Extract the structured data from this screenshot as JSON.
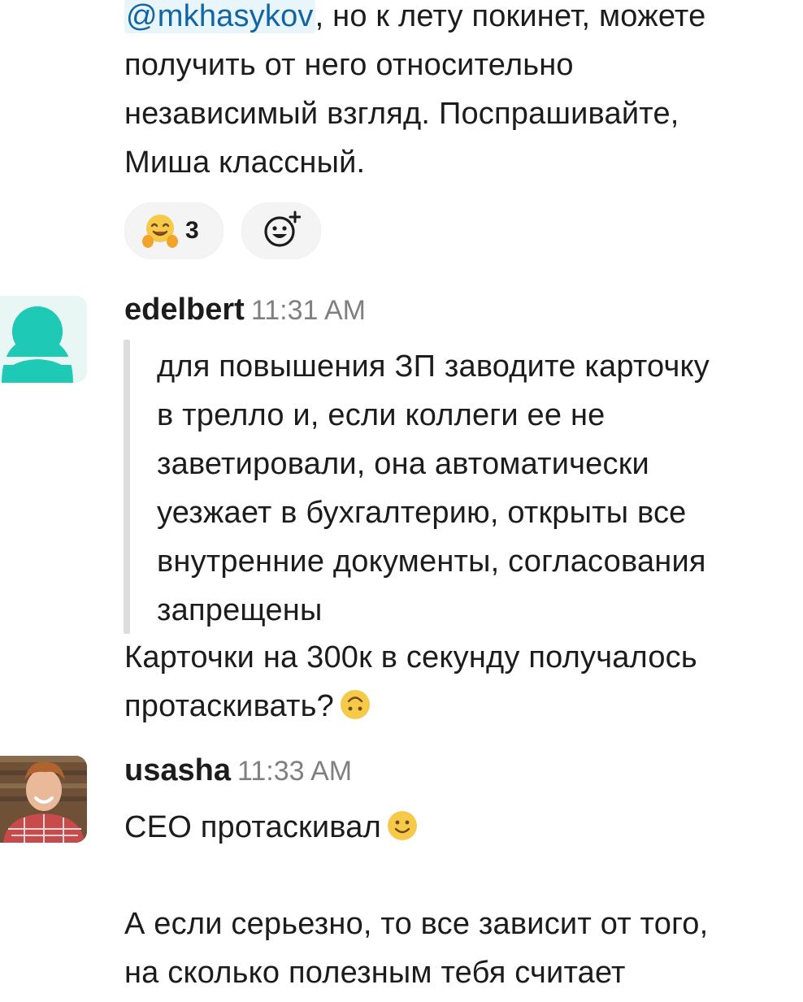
{
  "messages": {
    "first": {
      "mention": "@mkhasykov",
      "line1_rest": ", но к лету покинет, можете",
      "line2": "получить от него относительно",
      "line3": "независимый взгляд. Поспрашивайте,",
      "line4": "Миша классный.",
      "reactions": [
        {
          "icon": "hugging-face-icon",
          "count": "3"
        },
        {
          "icon": "add-reaction-icon"
        }
      ]
    },
    "edelbert": {
      "name": "edelbert",
      "time": "11:31 AM",
      "quote_lines": [
        "для повышения ЗП заводите карточку",
        "в трелло и, если коллеги ее не",
        "заветировали, она автоматически",
        "уезжает в бухгалтерию, открыты все",
        "внутренние документы, согласования",
        "запрещены"
      ],
      "reply_line1": "Карточки на 300к в секунду получалось",
      "reply_line2": "протаскивать?",
      "reply_emoji": "upside-down-face-icon"
    },
    "usasha": {
      "name": "usasha",
      "time": "11:33 AM",
      "line1": "СЕО протаскивал",
      "line1_emoji": "slightly-smiling-face-icon",
      "line2": "А если серьезно, то все зависит от того,",
      "line3": "на сколько полезным тебя считает"
    }
  }
}
